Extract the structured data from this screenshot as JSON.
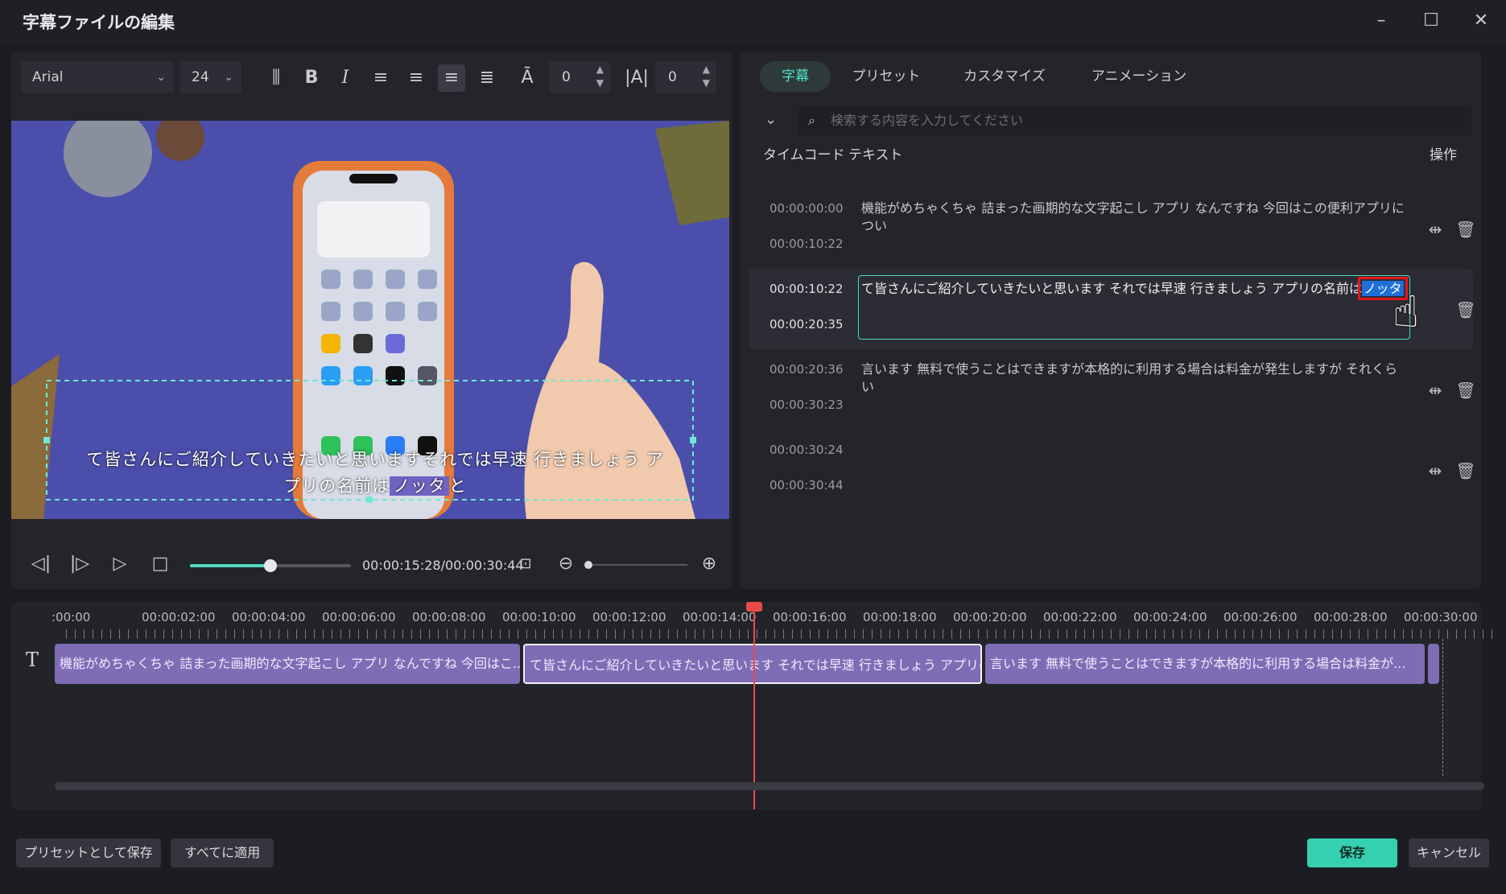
{
  "window": {
    "title": "字幕ファイルの編集"
  },
  "toolbar": {
    "font": "Arial",
    "size": "24",
    "char_spacing": "0",
    "line_spacing": "0",
    "icons": [
      "text-direction-icon",
      "bold-icon",
      "italic-icon",
      "align-left-icon",
      "align-right-icon",
      "align-center-icon",
      "align-justify-icon",
      "baseline-icon",
      "kerning-icon"
    ]
  },
  "preview": {
    "subtitle_line1": "て皆さんにご紹介していきたいと思いますそれでは早速 行きましょう ア",
    "subtitle_line2a": "プリの名前は",
    "subtitle_highlight": "ノッタ",
    "subtitle_line2b": "と"
  },
  "player": {
    "timecode": "00:00:15:28/00:00:30:44",
    "progress": 0.5
  },
  "tabs": [
    "字幕",
    "プリセット",
    "カスタマイズ",
    "アニメーション"
  ],
  "search": {
    "placeholder": "検索する内容を入力してください"
  },
  "columns": {
    "timecode": "タイムコード",
    "text": "テキスト",
    "actions": "操作"
  },
  "subtitles": [
    {
      "start": "00:00:00:00",
      "end": "00:00:10:22",
      "text": "機能がめちゃくちゃ 詰まった画期的な文字起こし アプリ なんですね 今回はこの便利アプリについ"
    },
    {
      "start": "00:00:10:22",
      "end": "00:00:20:35",
      "text": "て皆さんにご紹介していきたいと思います それでは早速 行きましょう アプリの名前は",
      "highlight": "ノッタ"
    },
    {
      "start": "00:00:20:36",
      "end": "00:00:30:23",
      "text": "言います 無料で使うことはできますが本格的に利用する場合は料金が発生しますが それくらい"
    },
    {
      "start": "00:00:30:24",
      "end": "00:00:30:44",
      "text": ""
    }
  ],
  "timeline": {
    "ticks": [
      ":00:00",
      "00:00:02:00",
      "00:00:04:00",
      "00:00:06:00",
      "00:00:08:00",
      "00:00:10:00",
      "00:00:12:00",
      "00:00:14:00",
      "00:00:16:00",
      "00:00:18:00",
      "00:00:20:00",
      "00:00:22:00",
      "00:00:24:00",
      "00:00:26:00",
      "00:00:28:00",
      "00:00:30:00"
    ],
    "clips": [
      "機能がめちゃくちゃ 詰まった画期的な文字起こし アプリ なんですね 今回はこ...",
      "て皆さんにご紹介していきたいと思います それでは早速 行きましょう アプリの...",
      "言います 無料で使うことはできますが本格的に利用する場合は料金が..."
    ]
  },
  "footer": {
    "save_preset": "プリセットとして保存",
    "apply_all": "すべてに適用",
    "save": "保存",
    "cancel": "キャンセル"
  },
  "colors": {
    "accent": "#35d0b0",
    "clip": "#7e6cb5",
    "playhead": "#e84a4a",
    "highlight": "#1f6fd8"
  }
}
